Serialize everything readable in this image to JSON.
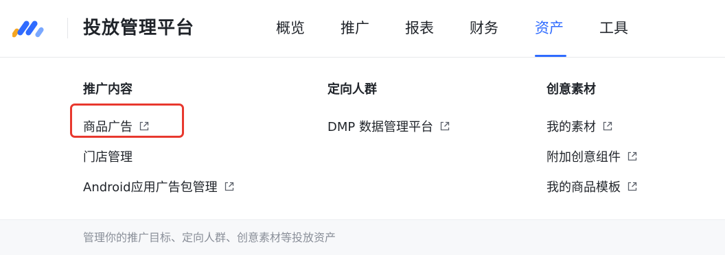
{
  "header": {
    "app_title": "投放管理平台",
    "logo_icon": "brand-logo-icon",
    "nav": [
      {
        "label": "概览",
        "active": false
      },
      {
        "label": "推广",
        "active": false
      },
      {
        "label": "报表",
        "active": false
      },
      {
        "label": "财务",
        "active": false
      },
      {
        "label": "资产",
        "active": true
      },
      {
        "label": "工具",
        "active": false
      }
    ],
    "accent_color": "#2f6bff"
  },
  "menu": {
    "columns": [
      {
        "title": "推广内容",
        "items": [
          {
            "label": "商品广告",
            "external": true,
            "highlighted": true
          },
          {
            "label": "门店管理",
            "external": false
          },
          {
            "label": "Android应用广告包管理",
            "external": true
          }
        ]
      },
      {
        "title": "定向人群",
        "items": [
          {
            "label": "DMP 数据管理平台",
            "external": true
          }
        ]
      },
      {
        "title": "创意素材",
        "items": [
          {
            "label": "我的素材",
            "external": true
          },
          {
            "label": "附加创意组件",
            "external": true
          },
          {
            "label": "我的商品模板",
            "external": true
          }
        ]
      }
    ],
    "external_icon": "external-link-icon",
    "highlight_color": "#e8382e"
  },
  "footer": {
    "description": "管理你的推广目标、定向人群、创意素材等投放资产"
  }
}
